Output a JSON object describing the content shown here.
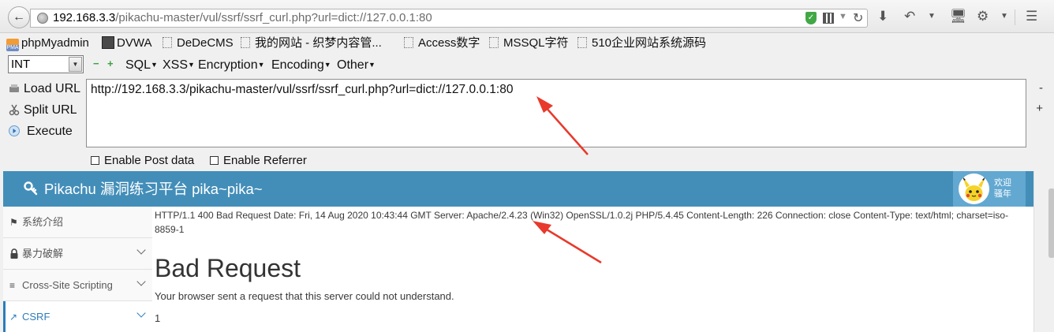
{
  "browser": {
    "url_host": "192.168.3.3",
    "url_path": "/pikachu-master/vul/ssrf/ssrf_curl.php?url=dict://127.0.0.1:80"
  },
  "bookmarks": [
    {
      "label": "phpMyadmin",
      "icon": "pma-icon"
    },
    {
      "label": "DVWA",
      "icon": "dvwa-icon"
    },
    {
      "label": "DeDeCMS",
      "icon": "page-icon"
    },
    {
      "label": "我的网站 - 织梦内容管...",
      "icon": "page-icon"
    },
    {
      "label": "Access数字",
      "icon": "page-icon"
    },
    {
      "label": "MSSQL字符",
      "icon": "page-icon"
    },
    {
      "label": "510企业网站系统源码",
      "icon": "page-icon"
    }
  ],
  "hackbar": {
    "select_value": "INT",
    "menus": [
      "SQL",
      "XSS",
      "Encryption",
      "Encoding",
      "Other"
    ],
    "load_url": "Load URL",
    "split_url": "Split URL",
    "execute": "Execute",
    "textarea_value": "http://192.168.3.3/pikachu-master/vul/ssrf/ssrf_curl.php?url=dict://127.0.0.1:80",
    "enable_post": "Enable Post data",
    "enable_referrer": "Enable Referrer"
  },
  "site": {
    "title": "Pikachu 漏洞练习平台 pika~pika~",
    "welcome_line1": "欢迎",
    "welcome_line2": "骚年"
  },
  "sidebar": [
    {
      "label": "系统介绍",
      "icon": "tags-icon",
      "chevron": false,
      "active": false
    },
    {
      "label": "暴力破解",
      "icon": "lock-icon",
      "chevron": true,
      "active": false
    },
    {
      "label": "Cross-Site Scripting",
      "icon": "list-icon",
      "chevron": true,
      "active": false
    },
    {
      "label": "CSRF",
      "icon": "share-icon",
      "chevron": true,
      "active": true
    }
  ],
  "response": {
    "header_line": "HTTP/1.1 400 Bad Request Date: Fri, 14 Aug 2020 10:43:44 GMT Server: Apache/2.4.23 (Win32) OpenSSL/1.0.2j PHP/5.4.45 Content-Length: 226 Connection: close Content-Type: text/html; charset=iso-8859-1",
    "title": "Bad Request",
    "message": "Your browser sent a request that this server could not understand.",
    "number": "1"
  },
  "colors": {
    "header_bg": "#438eb9",
    "active_link": "#2b7dbc",
    "annotation_arrow": "#e8392c"
  }
}
